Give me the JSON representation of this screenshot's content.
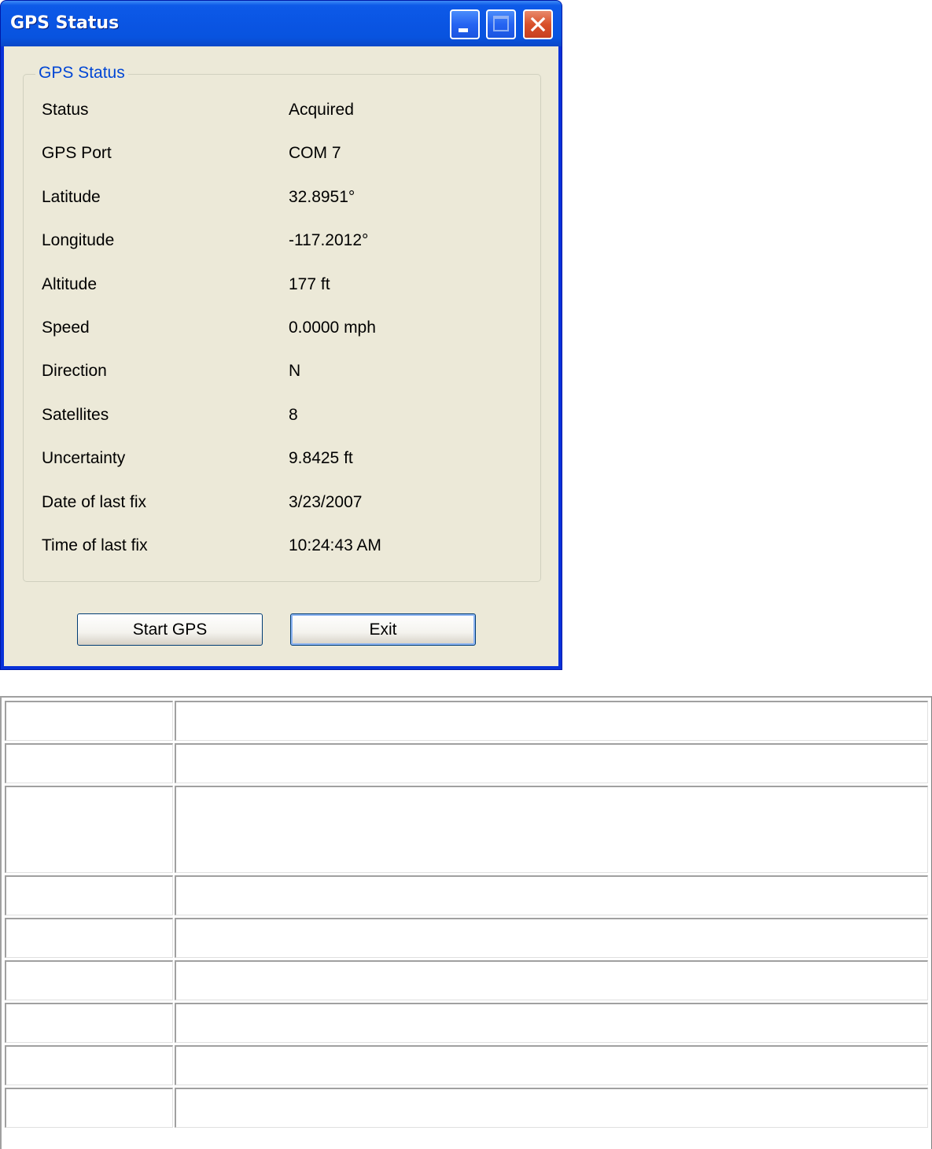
{
  "window": {
    "title": "GPS Status",
    "controls": {
      "minimize": "minimize-icon",
      "maximize": "maximize-icon",
      "close": "close-icon"
    }
  },
  "group": {
    "label": "GPS Status"
  },
  "rows": [
    {
      "label": "Status",
      "value": "Acquired"
    },
    {
      "label": "GPS Port",
      "value": "COM 7"
    },
    {
      "label": "Latitude",
      "value": "32.8951°"
    },
    {
      "label": "Longitude",
      "value": "-117.2012°"
    },
    {
      "label": "Altitude",
      "value": "177 ft"
    },
    {
      "label": "Speed",
      "value": "0.0000 mph"
    },
    {
      "label": "Direction",
      "value": "N"
    },
    {
      "label": "Satellites",
      "value": "8"
    },
    {
      "label": "Uncertainty",
      "value": "9.8425 ft"
    },
    {
      "label": "Date of last fix",
      "value": "3/23/2007"
    },
    {
      "label": "Time of last fix",
      "value": "10:24:43 AM"
    }
  ],
  "buttons": {
    "start": "Start GPS",
    "exit": "Exit"
  },
  "colors": {
    "title_bar": "#0a55e3",
    "client_bg": "#ece9d8",
    "group_label": "#0046d5",
    "close_button": "#d9512b"
  }
}
